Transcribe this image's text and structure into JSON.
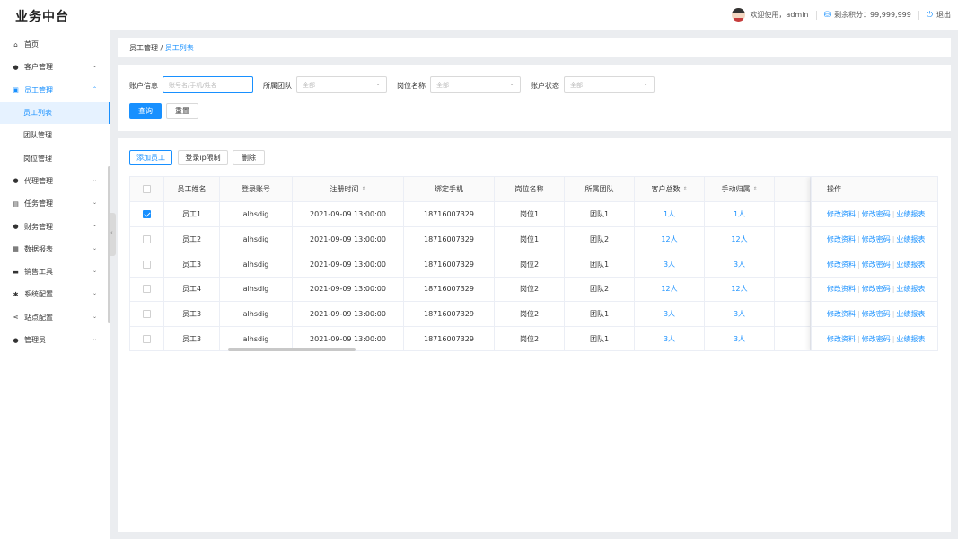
{
  "header": {
    "logo": "业务中台",
    "welcome": "欢迎使用，admin",
    "points": "剩余积分：99,999,999",
    "logout": "退出"
  },
  "sidebar": {
    "items": [
      {
        "label": "首页",
        "icon": "home-icon",
        "glyph": "⌂"
      },
      {
        "label": "客户管理",
        "icon": "user-icon",
        "glyph": "●"
      },
      {
        "label": "员工管理",
        "icon": "id-card-icon",
        "glyph": "▣"
      },
      {
        "label": "代理管理",
        "icon": "agent-icon",
        "glyph": "●"
      },
      {
        "label": "任务管理",
        "icon": "task-icon",
        "glyph": "▤"
      },
      {
        "label": "财务管理",
        "icon": "money-bag-icon",
        "glyph": "●"
      },
      {
        "label": "数据报表",
        "icon": "chart-icon",
        "glyph": "▦"
      },
      {
        "label": "销售工具",
        "icon": "briefcase-icon",
        "glyph": "▬"
      },
      {
        "label": "系统配置",
        "icon": "gear-icon",
        "glyph": "✱"
      },
      {
        "label": "站点配置",
        "icon": "share-icon",
        "glyph": "⋖"
      },
      {
        "label": "管理员",
        "icon": "admin-icon",
        "glyph": "●"
      }
    ],
    "subitems": [
      "员工列表",
      "团队管理",
      "岗位管理"
    ]
  },
  "breadcrumb": {
    "parent": "员工管理",
    "sep": " / ",
    "current": "员工列表"
  },
  "filters": {
    "account_label": "账户信息",
    "account_placeholder": "账号名/手机/姓名",
    "team_label": "所属团队",
    "team_value": "全部",
    "post_label": "岗位名称",
    "post_value": "全部",
    "status_label": "账户状态",
    "status_value": "全部",
    "query": "查询",
    "reset": "重置"
  },
  "toolbar": {
    "add": "添加员工",
    "ip_limit": "登录ip限制",
    "delete": "删除"
  },
  "table": {
    "headers": [
      "员工姓名",
      "登录账号",
      "注册时间",
      "绑定手机",
      "岗位名称",
      "所属团队",
      "客户总数",
      "手动归属",
      "操作"
    ],
    "actions": [
      "修改资料",
      "修改密码",
      "业绩报表"
    ],
    "rows": [
      {
        "name": "员工1",
        "account": "alhsdig",
        "time": "2021-09-09 13:00:00",
        "phone": "18716007329",
        "post": "岗位1",
        "team": "团队1",
        "customers": "1",
        "manual": "1",
        "unit": "人",
        "checked": true
      },
      {
        "name": "员工2",
        "account": "alhsdig",
        "time": "2021-09-09 13:00:00",
        "phone": "18716007329",
        "post": "岗位1",
        "team": "团队2",
        "customers": "12",
        "manual": "12",
        "unit": "人",
        "checked": false
      },
      {
        "name": "员工3",
        "account": "alhsdig",
        "time": "2021-09-09 13:00:00",
        "phone": "18716007329",
        "post": "岗位2",
        "team": "团队1",
        "customers": "3",
        "manual": "3",
        "unit": "人",
        "checked": false
      },
      {
        "name": "员工4",
        "account": "alhsdig",
        "time": "2021-09-09 13:00:00",
        "phone": "18716007329",
        "post": "岗位2",
        "team": "团队2",
        "customers": "12",
        "manual": "12",
        "unit": "人",
        "checked": false
      },
      {
        "name": "员工3",
        "account": "alhsdig",
        "time": "2021-09-09 13:00:00",
        "phone": "18716007329",
        "post": "岗位2",
        "team": "团队1",
        "customers": "3",
        "manual": "3",
        "unit": "人",
        "checked": false
      },
      {
        "name": "员工3",
        "account": "alhsdig",
        "time": "2021-09-09 13:00:00",
        "phone": "18716007329",
        "post": "岗位2",
        "team": "团队1",
        "customers": "3",
        "manual": "3",
        "unit": "人",
        "checked": false
      }
    ]
  },
  "colors": {
    "accent": "#1890ff",
    "bg": "#ebedf0"
  }
}
